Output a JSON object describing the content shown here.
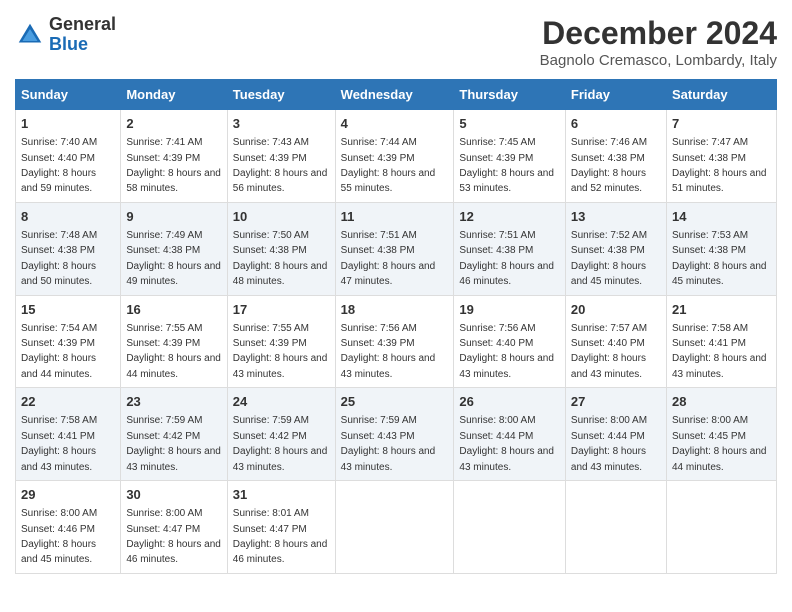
{
  "header": {
    "logo_general": "General",
    "logo_blue": "Blue",
    "month_title": "December 2024",
    "location": "Bagnolo Cremasco, Lombardy, Italy"
  },
  "days_of_week": [
    "Sunday",
    "Monday",
    "Tuesday",
    "Wednesday",
    "Thursday",
    "Friday",
    "Saturday"
  ],
  "weeks": [
    [
      {
        "day": "1",
        "sunrise": "Sunrise: 7:40 AM",
        "sunset": "Sunset: 4:40 PM",
        "daylight": "Daylight: 8 hours and 59 minutes."
      },
      {
        "day": "2",
        "sunrise": "Sunrise: 7:41 AM",
        "sunset": "Sunset: 4:39 PM",
        "daylight": "Daylight: 8 hours and 58 minutes."
      },
      {
        "day": "3",
        "sunrise": "Sunrise: 7:43 AM",
        "sunset": "Sunset: 4:39 PM",
        "daylight": "Daylight: 8 hours and 56 minutes."
      },
      {
        "day": "4",
        "sunrise": "Sunrise: 7:44 AM",
        "sunset": "Sunset: 4:39 PM",
        "daylight": "Daylight: 8 hours and 55 minutes."
      },
      {
        "day": "5",
        "sunrise": "Sunrise: 7:45 AM",
        "sunset": "Sunset: 4:39 PM",
        "daylight": "Daylight: 8 hours and 53 minutes."
      },
      {
        "day": "6",
        "sunrise": "Sunrise: 7:46 AM",
        "sunset": "Sunset: 4:38 PM",
        "daylight": "Daylight: 8 hours and 52 minutes."
      },
      {
        "day": "7",
        "sunrise": "Sunrise: 7:47 AM",
        "sunset": "Sunset: 4:38 PM",
        "daylight": "Daylight: 8 hours and 51 minutes."
      }
    ],
    [
      {
        "day": "8",
        "sunrise": "Sunrise: 7:48 AM",
        "sunset": "Sunset: 4:38 PM",
        "daylight": "Daylight: 8 hours and 50 minutes."
      },
      {
        "day": "9",
        "sunrise": "Sunrise: 7:49 AM",
        "sunset": "Sunset: 4:38 PM",
        "daylight": "Daylight: 8 hours and 49 minutes."
      },
      {
        "day": "10",
        "sunrise": "Sunrise: 7:50 AM",
        "sunset": "Sunset: 4:38 PM",
        "daylight": "Daylight: 8 hours and 48 minutes."
      },
      {
        "day": "11",
        "sunrise": "Sunrise: 7:51 AM",
        "sunset": "Sunset: 4:38 PM",
        "daylight": "Daylight: 8 hours and 47 minutes."
      },
      {
        "day": "12",
        "sunrise": "Sunrise: 7:51 AM",
        "sunset": "Sunset: 4:38 PM",
        "daylight": "Daylight: 8 hours and 46 minutes."
      },
      {
        "day": "13",
        "sunrise": "Sunrise: 7:52 AM",
        "sunset": "Sunset: 4:38 PM",
        "daylight": "Daylight: 8 hours and 45 minutes."
      },
      {
        "day": "14",
        "sunrise": "Sunrise: 7:53 AM",
        "sunset": "Sunset: 4:38 PM",
        "daylight": "Daylight: 8 hours and 45 minutes."
      }
    ],
    [
      {
        "day": "15",
        "sunrise": "Sunrise: 7:54 AM",
        "sunset": "Sunset: 4:39 PM",
        "daylight": "Daylight: 8 hours and 44 minutes."
      },
      {
        "day": "16",
        "sunrise": "Sunrise: 7:55 AM",
        "sunset": "Sunset: 4:39 PM",
        "daylight": "Daylight: 8 hours and 44 minutes."
      },
      {
        "day": "17",
        "sunrise": "Sunrise: 7:55 AM",
        "sunset": "Sunset: 4:39 PM",
        "daylight": "Daylight: 8 hours and 43 minutes."
      },
      {
        "day": "18",
        "sunrise": "Sunrise: 7:56 AM",
        "sunset": "Sunset: 4:39 PM",
        "daylight": "Daylight: 8 hours and 43 minutes."
      },
      {
        "day": "19",
        "sunrise": "Sunrise: 7:56 AM",
        "sunset": "Sunset: 4:40 PM",
        "daylight": "Daylight: 8 hours and 43 minutes."
      },
      {
        "day": "20",
        "sunrise": "Sunrise: 7:57 AM",
        "sunset": "Sunset: 4:40 PM",
        "daylight": "Daylight: 8 hours and 43 minutes."
      },
      {
        "day": "21",
        "sunrise": "Sunrise: 7:58 AM",
        "sunset": "Sunset: 4:41 PM",
        "daylight": "Daylight: 8 hours and 43 minutes."
      }
    ],
    [
      {
        "day": "22",
        "sunrise": "Sunrise: 7:58 AM",
        "sunset": "Sunset: 4:41 PM",
        "daylight": "Daylight: 8 hours and 43 minutes."
      },
      {
        "day": "23",
        "sunrise": "Sunrise: 7:59 AM",
        "sunset": "Sunset: 4:42 PM",
        "daylight": "Daylight: 8 hours and 43 minutes."
      },
      {
        "day": "24",
        "sunrise": "Sunrise: 7:59 AM",
        "sunset": "Sunset: 4:42 PM",
        "daylight": "Daylight: 8 hours and 43 minutes."
      },
      {
        "day": "25",
        "sunrise": "Sunrise: 7:59 AM",
        "sunset": "Sunset: 4:43 PM",
        "daylight": "Daylight: 8 hours and 43 minutes."
      },
      {
        "day": "26",
        "sunrise": "Sunrise: 8:00 AM",
        "sunset": "Sunset: 4:44 PM",
        "daylight": "Daylight: 8 hours and 43 minutes."
      },
      {
        "day": "27",
        "sunrise": "Sunrise: 8:00 AM",
        "sunset": "Sunset: 4:44 PM",
        "daylight": "Daylight: 8 hours and 43 minutes."
      },
      {
        "day": "28",
        "sunrise": "Sunrise: 8:00 AM",
        "sunset": "Sunset: 4:45 PM",
        "daylight": "Daylight: 8 hours and 44 minutes."
      }
    ],
    [
      {
        "day": "29",
        "sunrise": "Sunrise: 8:00 AM",
        "sunset": "Sunset: 4:46 PM",
        "daylight": "Daylight: 8 hours and 45 minutes."
      },
      {
        "day": "30",
        "sunrise": "Sunrise: 8:00 AM",
        "sunset": "Sunset: 4:47 PM",
        "daylight": "Daylight: 8 hours and 46 minutes."
      },
      {
        "day": "31",
        "sunrise": "Sunrise: 8:01 AM",
        "sunset": "Sunset: 4:47 PM",
        "daylight": "Daylight: 8 hours and 46 minutes."
      },
      {
        "day": "",
        "sunrise": "",
        "sunset": "",
        "daylight": ""
      },
      {
        "day": "",
        "sunrise": "",
        "sunset": "",
        "daylight": ""
      },
      {
        "day": "",
        "sunrise": "",
        "sunset": "",
        "daylight": ""
      },
      {
        "day": "",
        "sunrise": "",
        "sunset": "",
        "daylight": ""
      }
    ]
  ]
}
